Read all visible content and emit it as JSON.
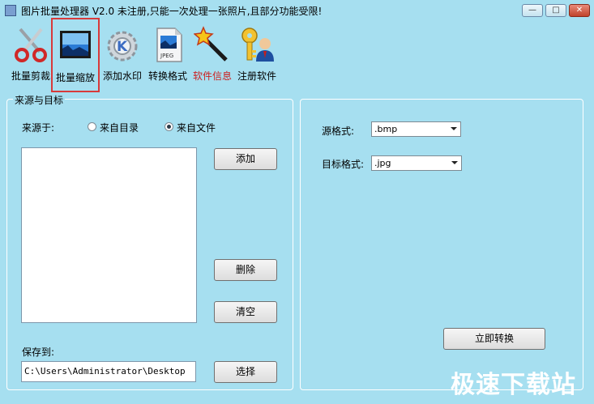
{
  "window": {
    "title": "图片批量处理器 V2.0  未注册,只能一次处理一张照片,且部分功能受限!",
    "minimize": "—",
    "maximize": "□",
    "close": "✕"
  },
  "toolbar": {
    "items": [
      {
        "label": "批量剪裁",
        "icon": "scissors-icon",
        "color": "#000000"
      },
      {
        "label": "批量缩放",
        "icon": "picture-icon",
        "color": "#000000"
      },
      {
        "label": "添加水印",
        "icon": "kde-gear-icon",
        "color": "#000000"
      },
      {
        "label": "转换格式",
        "icon": "jpeg-file-icon",
        "color": "#000000"
      },
      {
        "label": "软件信息",
        "icon": "magic-wand-icon",
        "color": "#cc2020"
      },
      {
        "label": "注册软件",
        "icon": "key-user-icon",
        "color": "#000000"
      }
    ]
  },
  "source_group": {
    "title": "来源与目标",
    "source_label": "来源于:",
    "from_dir": "来自目录",
    "from_file": "来自文件",
    "add_button": "添加",
    "delete_button": "删除",
    "clear_button": "清空",
    "save_label": "保存到:",
    "save_path": "C:\\Users\\Administrator\\Desktop",
    "choose_button": "选择"
  },
  "convert_group": {
    "src_label": "源格式:",
    "src_value": ".bmp",
    "dst_label": "目标格式:",
    "dst_value": ".jpg",
    "convert_button": "立即转换"
  },
  "watermark": "极速下载站"
}
